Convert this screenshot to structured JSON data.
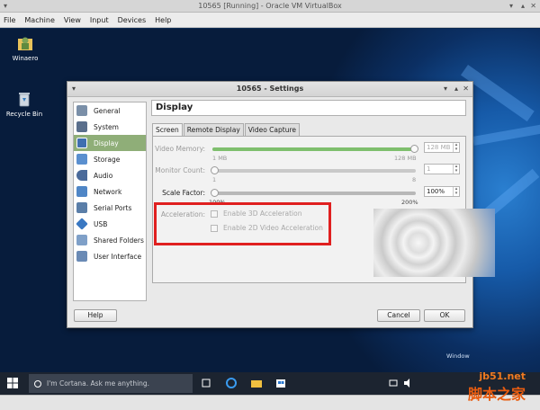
{
  "vbox": {
    "title": "10565 [Running] - Oracle VM VirtualBox",
    "menu": [
      "File",
      "Machine",
      "View",
      "Input",
      "Devices",
      "Help"
    ]
  },
  "desktop": {
    "icons": [
      {
        "label": "Winaero",
        "icon": "user-folder-icon"
      },
      {
        "label": "Recycle Bin",
        "icon": "recycle-bin-icon"
      }
    ],
    "watermark": "Window"
  },
  "settings": {
    "title": "10565 - Settings",
    "categories": [
      {
        "label": "General",
        "icon": "general-icon",
        "color": "#7a8fa8"
      },
      {
        "label": "System",
        "icon": "system-icon",
        "color": "#5a6f8c"
      },
      {
        "label": "Display",
        "icon": "display-icon",
        "color": "#3f6fb0"
      },
      {
        "label": "Storage",
        "icon": "storage-icon",
        "color": "#5a8fcf"
      },
      {
        "label": "Audio",
        "icon": "audio-icon",
        "color": "#4a6a9a"
      },
      {
        "label": "Network",
        "icon": "network-icon",
        "color": "#4f86c6"
      },
      {
        "label": "Serial Ports",
        "icon": "serial-ports-icon",
        "color": "#5a7ea8"
      },
      {
        "label": "USB",
        "icon": "usb-icon",
        "color": "#3a78c2"
      },
      {
        "label": "Shared Folders",
        "icon": "shared-folders-icon",
        "color": "#7fa0c8"
      },
      {
        "label": "User Interface",
        "icon": "user-interface-icon",
        "color": "#6a8ab5"
      }
    ],
    "selected_category": "Display",
    "page_title": "Display",
    "tabs": [
      "Screen",
      "Remote Display",
      "Video Capture"
    ],
    "active_tab": "Screen",
    "screen": {
      "video_memory": {
        "label": "Video Memory:",
        "min_label": "1 MB",
        "max_label": "128 MB",
        "value": "128 MB",
        "fraction": 1.0
      },
      "monitor_count": {
        "label": "Monitor Count:",
        "min_label": "1",
        "max_label": "8",
        "value": "1",
        "fraction": 0.0
      },
      "scale_factor": {
        "label": "Scale Factor:",
        "min_label": "100%",
        "max_label": "200%",
        "value": "100%",
        "fraction": 0.0
      },
      "acceleration": {
        "label": "Acceleration:",
        "option_3d": "Enable 3D Acceleration",
        "option_2d": "Enable 2D Video Acceleration"
      }
    },
    "buttons": {
      "help": "Help",
      "cancel": "Cancel",
      "ok": "OK"
    }
  },
  "taskbar": {
    "search_placeholder": "I'm Cortana. Ask me anything."
  },
  "watermark_site": {
    "line1": "jb51.net",
    "line2": "脚本之家"
  },
  "colors": {
    "selection": "#8fae78",
    "highlight": "#e02020",
    "taskbar": "#1c2430"
  }
}
